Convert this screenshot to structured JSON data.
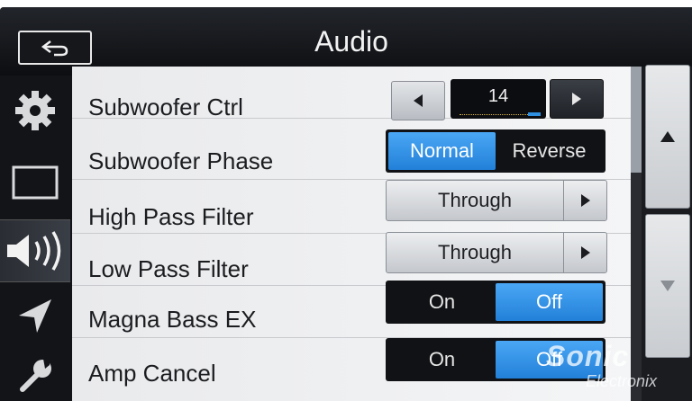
{
  "header": {
    "title": "Audio",
    "back_icon": "return-arrow-icon"
  },
  "sidebar": {
    "items": [
      {
        "name": "settings",
        "icon": "gear-icon",
        "active": false
      },
      {
        "name": "display",
        "icon": "screen-rectangle-icon",
        "active": false
      },
      {
        "name": "audio",
        "icon": "speaker-icon",
        "active": true
      },
      {
        "name": "navigation",
        "icon": "navigation-arrow-icon",
        "active": false
      },
      {
        "name": "tools",
        "icon": "wrench-icon",
        "active": false
      }
    ]
  },
  "rows": {
    "subwoofer_ctrl": {
      "label": "Subwoofer Ctrl",
      "value": "14"
    },
    "subwoofer_phase": {
      "label": "Subwoofer Phase",
      "option_a": "Normal",
      "option_b": "Reverse",
      "selected": "Normal"
    },
    "high_pass_filter": {
      "label": "High Pass Filter",
      "value": "Through"
    },
    "low_pass_filter": {
      "label": "Low Pass Filter",
      "value": "Through"
    },
    "magna_bass_ex": {
      "label": "Magna Bass EX",
      "option_a": "On",
      "option_b": "Off",
      "selected": "Off"
    },
    "amp_cancel": {
      "label": "Amp Cancel",
      "option_a": "On",
      "option_b": "Off",
      "selected": "Off"
    }
  },
  "scroll": {
    "up_icon": "triangle-up-icon",
    "down_icon": "triangle-down-icon"
  },
  "watermark": {
    "main": "Sonic",
    "sub": "Electronix"
  },
  "colors": {
    "accent": "#2f8fe0",
    "background": "#111317",
    "list_bg": "#eeeff1"
  }
}
